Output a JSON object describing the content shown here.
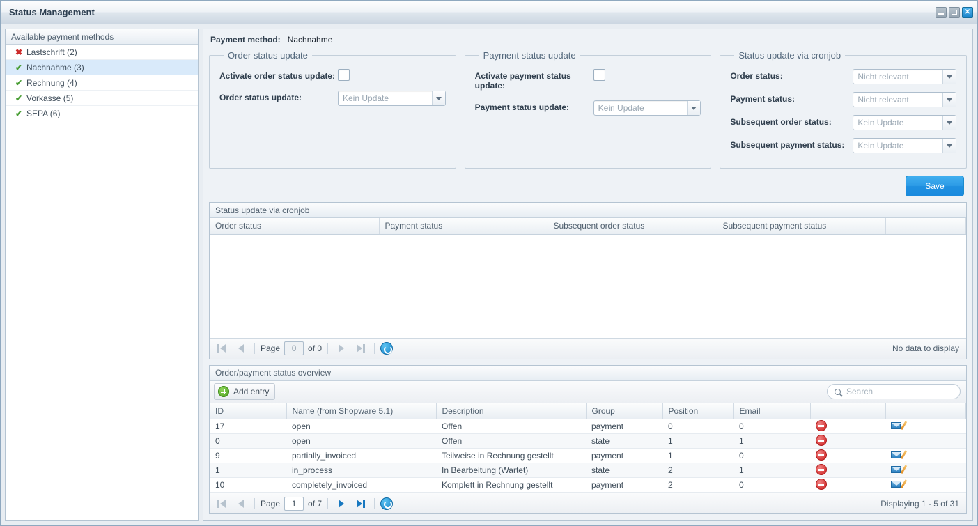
{
  "window": {
    "title": "Status Management",
    "minimize_label": "–",
    "maximize_label": "□",
    "close_label": "✕"
  },
  "sidebar": {
    "header": "Available payment methods",
    "items": [
      {
        "label": "Lastschrift (2)",
        "icon": "cross-icon",
        "glyph": "✖",
        "active": false,
        "selected": false
      },
      {
        "label": "Nachnahme (3)",
        "icon": "check-icon",
        "glyph": "✔",
        "active": true,
        "selected": true
      },
      {
        "label": "Rechnung (4)",
        "icon": "check-icon",
        "glyph": "✔",
        "active": true,
        "selected": false
      },
      {
        "label": "Vorkasse (5)",
        "icon": "check-icon",
        "glyph": "✔",
        "active": true,
        "selected": false
      },
      {
        "label": "SEPA (6)",
        "icon": "check-icon",
        "glyph": "✔",
        "active": true,
        "selected": false
      }
    ]
  },
  "main": {
    "payment_method_label": "Payment method:",
    "payment_method_value": "Nachnahme",
    "order_status_update": {
      "legend": "Order status update",
      "activate_label": "Activate order status update:",
      "activate_checked": false,
      "update_label": "Order status update:",
      "update_value": "Kein Update"
    },
    "payment_status_update": {
      "legend": "Payment status update",
      "activate_label": "Activate payment status update:",
      "activate_checked": false,
      "update_label": "Payment status update:",
      "update_value": "Kein Update"
    },
    "cronjob": {
      "legend": "Status update via cronjob",
      "order_status_label": "Order status:",
      "order_status_value": "Nicht relevant",
      "payment_status_label": "Payment status:",
      "payment_status_value": "Nicht relevant",
      "subsequent_order_label": "Subsequent order status:",
      "subsequent_order_value": "Kein Update",
      "subsequent_payment_label": "Subsequent payment status:",
      "subsequent_payment_value": "Kein Update"
    },
    "save_label": "Save",
    "save_color": "#1f90e0"
  },
  "cronjob_grid": {
    "title": "Status update via cronjob",
    "columns": [
      "Order status",
      "Payment status",
      "Subsequent order status",
      "Subsequent payment status",
      ""
    ],
    "rows": [],
    "pager": {
      "page_label": "Page",
      "page_value": "0",
      "of_label": "of 0",
      "status": "No data to display"
    }
  },
  "overview_grid": {
    "title": "Order/payment status overview",
    "add_entry_label": "Add entry",
    "search_placeholder": "Search",
    "search_value": "",
    "columns": [
      "ID",
      "Name (from Shopware 5.1)",
      "Description",
      "Group",
      "Position",
      "Email",
      "",
      ""
    ],
    "rows": [
      {
        "id": "17",
        "name": "open",
        "description": "Offen",
        "group": "payment",
        "position": "0",
        "email": "0",
        "has_delete": true,
        "has_edit": true
      },
      {
        "id": "0",
        "name": "open",
        "description": "Offen",
        "group": "state",
        "position": "1",
        "email": "1",
        "has_delete": true,
        "has_edit": false
      },
      {
        "id": "9",
        "name": "partially_invoiced",
        "description": "Teilweise in Rechnung gestellt",
        "group": "payment",
        "position": "1",
        "email": "0",
        "has_delete": true,
        "has_edit": true
      },
      {
        "id": "1",
        "name": "in_process",
        "description": "In Bearbeitung (Wartet)",
        "group": "state",
        "position": "2",
        "email": "1",
        "has_delete": true,
        "has_edit": true
      },
      {
        "id": "10",
        "name": "completely_invoiced",
        "description": "Komplett in Rechnung gestellt",
        "group": "payment",
        "position": "2",
        "email": "0",
        "has_delete": true,
        "has_edit": true
      }
    ],
    "pager": {
      "page_label": "Page",
      "page_value": "1",
      "of_label": "of 7",
      "status": "Displaying 1 - 5 of 31"
    }
  }
}
